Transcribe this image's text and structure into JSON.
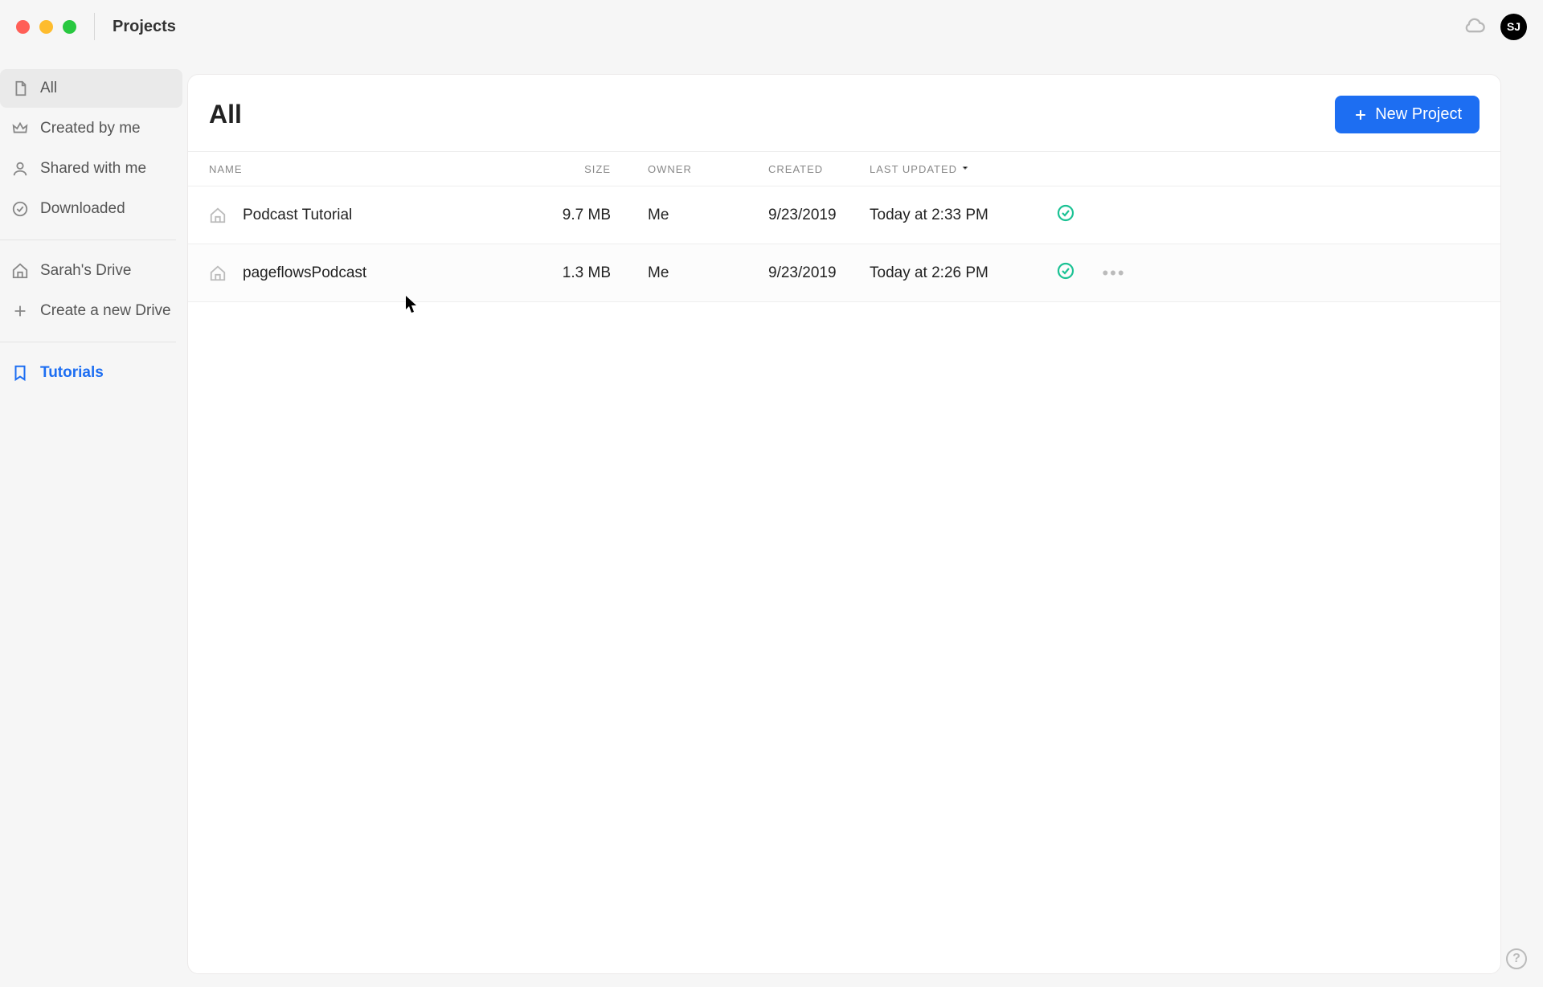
{
  "window": {
    "title": "Projects"
  },
  "user": {
    "initials": "SJ"
  },
  "sidebar": {
    "filters": [
      {
        "label": "All",
        "icon": "document"
      },
      {
        "label": "Created by me",
        "icon": "crown"
      },
      {
        "label": "Shared with me",
        "icon": "person"
      },
      {
        "label": "Downloaded",
        "icon": "check-circle"
      }
    ],
    "drives": [
      {
        "label": "Sarah's Drive"
      },
      {
        "label": "Create a new Drive"
      }
    ],
    "tutorials_label": "Tutorials"
  },
  "main": {
    "title": "All",
    "new_project_label": "New Project",
    "columns": {
      "name": "NAME",
      "size": "SIZE",
      "owner": "OWNER",
      "created": "CREATED",
      "last_updated": "LAST UPDATED"
    },
    "rows": [
      {
        "name": "Podcast Tutorial",
        "size": "9.7 MB",
        "owner": "Me",
        "created": "9/23/2019",
        "last_updated": "Today at 2:33 PM",
        "synced": true,
        "hovered": false
      },
      {
        "name": "pageflowsPodcast",
        "size": "1.3 MB",
        "owner": "Me",
        "created": "9/23/2019",
        "last_updated": "Today at 2:26 PM",
        "synced": true,
        "hovered": true
      }
    ]
  },
  "help": {
    "label": "?"
  }
}
